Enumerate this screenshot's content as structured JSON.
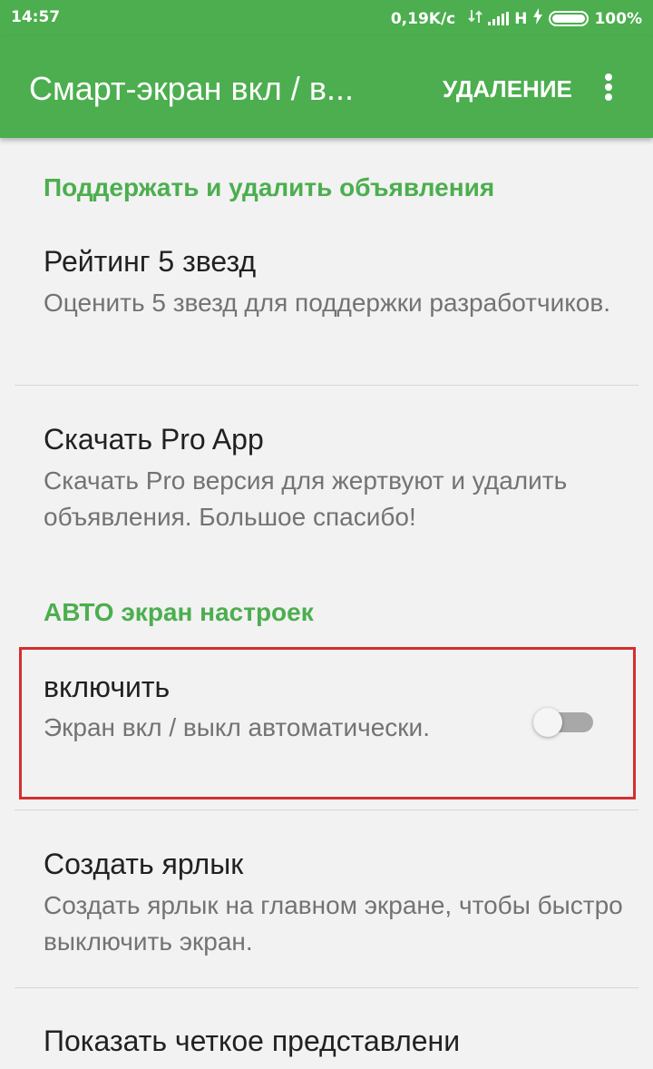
{
  "status_bar": {
    "time": "14:57",
    "network_speed": "0,19K/c",
    "network_type": "H",
    "battery_percent": "100%",
    "battery_level": 1.0,
    "icons": [
      "data-transfer-icon",
      "signal-icon",
      "charging-icon",
      "battery-icon"
    ]
  },
  "app_bar": {
    "title": "Смарт-экран вкл / в...",
    "action_label": "УДАЛЕНИЕ",
    "overflow_icon": "more-vertical-icon"
  },
  "sections": [
    {
      "header": "Поддержать и удалить объявления",
      "items": [
        {
          "title": "Рейтинг 5 звезд",
          "summary": "Оценить 5 звезд для поддержки разработчиков."
        },
        {
          "title": "Скачать Pro App",
          "summary": "Скачать Pro версия для жертвуют и удалить объявления. Большое спасибо!"
        }
      ]
    },
    {
      "header": "АВТО экран настроек",
      "items": [
        {
          "title": "включить",
          "summary": "Экран вкл / выкл автоматически.",
          "switch_on": false
        },
        {
          "title": "Создать ярлык",
          "summary": "Создать ярлык на главном экране, чтобы быстро выключить экран."
        },
        {
          "title": "Показать четкое представлени"
        }
      ]
    }
  ],
  "colors": {
    "accent": "#4cae4f",
    "highlight_border": "#d32f2f",
    "title_text": "#212121",
    "summary_text": "#737373",
    "background": "#f2f2f2"
  }
}
